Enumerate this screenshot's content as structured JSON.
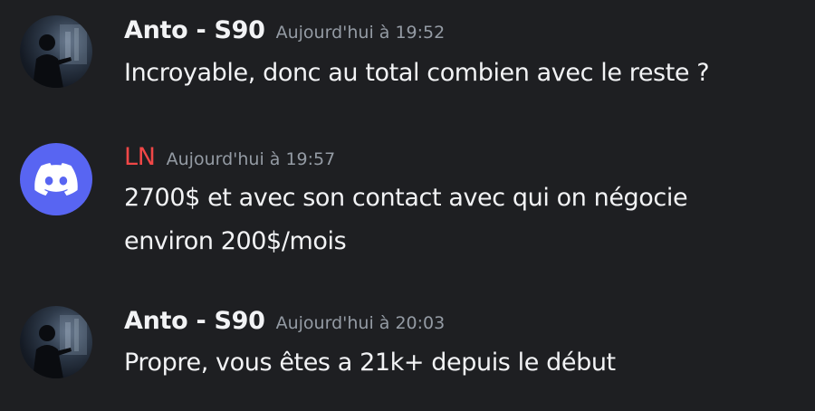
{
  "messages": [
    {
      "author": "Anto - S90",
      "timestamp": "Aujourd'hui à 19:52",
      "lines": [
        "Incroyable, donc au total combien avec le reste ?"
      ],
      "avatar": "user-photo-avatar"
    },
    {
      "author": "LN",
      "timestamp": "Aujourd'hui à 19:57",
      "lines": [
        "2700$ et avec son contact avec qui on négocie",
        "environ 200$/mois"
      ],
      "avatar": "discord-logo-avatar",
      "author_color": "#f04747"
    },
    {
      "author": "Anto - S90",
      "timestamp": "Aujourd'hui à 20:03",
      "lines": [
        "Propre, vous êtes a 21k+ depuis le début"
      ],
      "avatar": "user-photo-avatar"
    }
  ],
  "colors": {
    "background": "#1e1f22",
    "text": "#f2f3f5",
    "timestamp": "#949ba4",
    "discord_blurple": "#5865f2"
  }
}
